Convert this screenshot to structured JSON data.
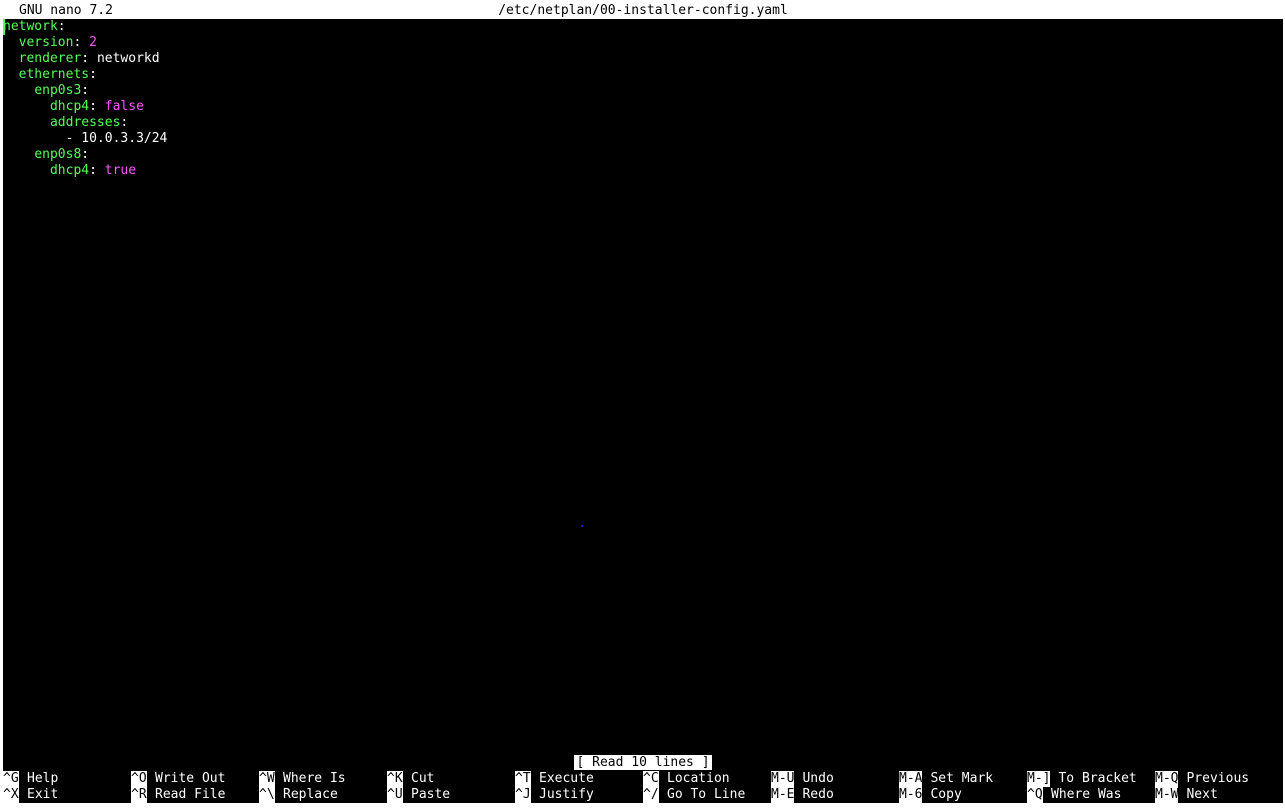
{
  "titlebar": {
    "app": "GNU nano 7.2",
    "filename": "/etc/netplan/00-installer-config.yaml"
  },
  "editor": {
    "lines": [
      {
        "indent": "",
        "key": "network",
        "sep": ":",
        "value": "",
        "value_type": "none"
      },
      {
        "indent": "  ",
        "key": "version",
        "sep": ": ",
        "value": "2",
        "value_type": "num"
      },
      {
        "indent": "  ",
        "key": "renderer",
        "sep": ": ",
        "value": "networkd",
        "value_type": "str"
      },
      {
        "indent": "  ",
        "key": "ethernets",
        "sep": ":",
        "value": "",
        "value_type": "none"
      },
      {
        "indent": "    ",
        "key": "enp0s3",
        "sep": ":",
        "value": "",
        "value_type": "none"
      },
      {
        "indent": "      ",
        "key": "dhcp4",
        "sep": ": ",
        "value": "false",
        "value_type": "bool"
      },
      {
        "indent": "      ",
        "key": "addresses",
        "sep": ":",
        "value": "",
        "value_type": "none"
      },
      {
        "indent": "        ",
        "key": "",
        "sep": "- ",
        "value": "10.0.3.3/24",
        "value_type": "str"
      },
      {
        "indent": "    ",
        "key": "enp0s8",
        "sep": ":",
        "value": "",
        "value_type": "none"
      },
      {
        "indent": "      ",
        "key": "dhcp4",
        "sep": ": ",
        "value": "true",
        "value_type": "bool"
      }
    ]
  },
  "status": {
    "message": "[ Read 10 lines ]"
  },
  "shortcuts": {
    "row1": [
      {
        "key": "^G",
        "label": "Help"
      },
      {
        "key": "^O",
        "label": "Write Out"
      },
      {
        "key": "^W",
        "label": "Where Is"
      },
      {
        "key": "^K",
        "label": "Cut"
      },
      {
        "key": "^T",
        "label": "Execute"
      },
      {
        "key": "^C",
        "label": "Location"
      },
      {
        "key": "M-U",
        "label": "Undo"
      },
      {
        "key": "M-A",
        "label": "Set Mark"
      },
      {
        "key": "M-]",
        "label": "To Bracket"
      },
      {
        "key": "M-Q",
        "label": "Previous"
      }
    ],
    "row2": [
      {
        "key": "^X",
        "label": "Exit"
      },
      {
        "key": "^R",
        "label": "Read File"
      },
      {
        "key": "^\\",
        "label": "Replace"
      },
      {
        "key": "^U",
        "label": "Paste"
      },
      {
        "key": "^J",
        "label": "Justify"
      },
      {
        "key": "^/",
        "label": "Go To Line"
      },
      {
        "key": "M-E",
        "label": "Redo"
      },
      {
        "key": "M-6",
        "label": "Copy"
      },
      {
        "key": "^Q",
        "label": "Where Was"
      },
      {
        "key": "M-W",
        "label": "Next"
      }
    ]
  },
  "colors": {
    "background": "#000000",
    "key": "#54ff54",
    "literal": "#ff54ff",
    "text": "#ffffff"
  }
}
